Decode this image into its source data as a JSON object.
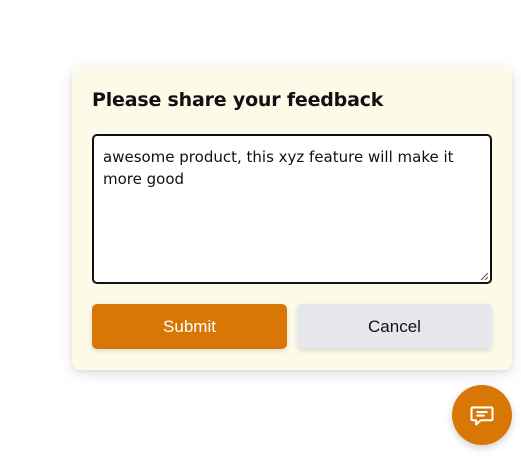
{
  "feedback": {
    "title": "Please share your feedback",
    "textarea_value": "awesome product, this xyz feature will make it more good",
    "submit_label": "Submit",
    "cancel_label": "Cancel"
  },
  "chat_button": {
    "icon": "chat-message-icon"
  },
  "colors": {
    "accent": "#d97706",
    "card_background": "#fdfae8",
    "cancel_background": "#e5e7eb"
  }
}
